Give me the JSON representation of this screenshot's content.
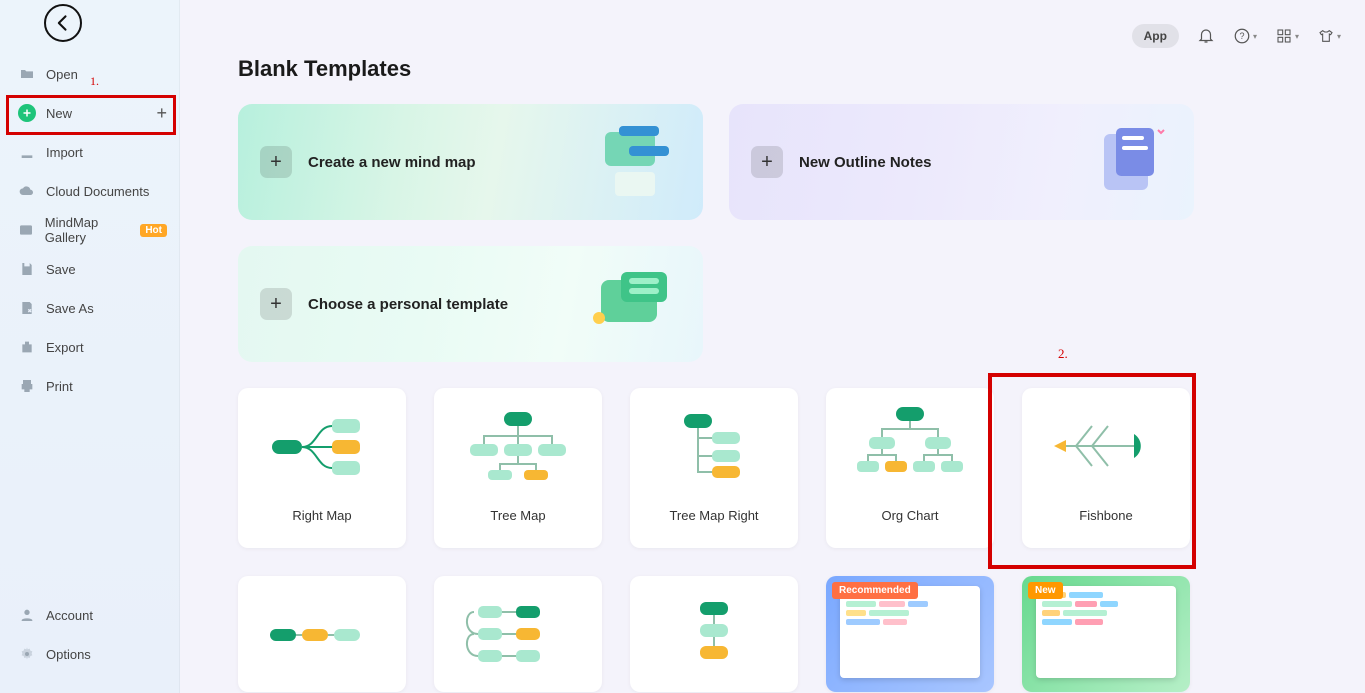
{
  "topbar": {
    "app_label": "App"
  },
  "sidebar": {
    "items": [
      {
        "icon": "folder-icon",
        "label": "Open"
      },
      {
        "icon": "plus-circle-icon",
        "label": "New"
      },
      {
        "icon": "import-icon",
        "label": "Import"
      },
      {
        "icon": "cloud-icon",
        "label": "Cloud Documents"
      },
      {
        "icon": "gallery-icon",
        "label": "MindMap Gallery",
        "badge": "Hot"
      },
      {
        "icon": "save-icon",
        "label": "Save"
      },
      {
        "icon": "saveas-icon",
        "label": "Save As"
      },
      {
        "icon": "export-icon",
        "label": "Export"
      },
      {
        "icon": "print-icon",
        "label": "Print"
      }
    ],
    "bottom": [
      {
        "icon": "account-icon",
        "label": "Account"
      },
      {
        "icon": "options-icon",
        "label": "Options"
      }
    ]
  },
  "annotations": {
    "one": "1.",
    "two": "2."
  },
  "main": {
    "title": "Blank Templates",
    "big_cards": {
      "mindmap": "Create a new mind map",
      "outline": "New Outline Notes",
      "personal": "Choose a personal template"
    },
    "templates": [
      {
        "label": "Right Map"
      },
      {
        "label": "Tree Map"
      },
      {
        "label": "Tree Map Right"
      },
      {
        "label": "Org Chart"
      },
      {
        "label": "Fishbone"
      }
    ],
    "extra_badges": {
      "recommended": "Recommended",
      "new": "New"
    }
  }
}
